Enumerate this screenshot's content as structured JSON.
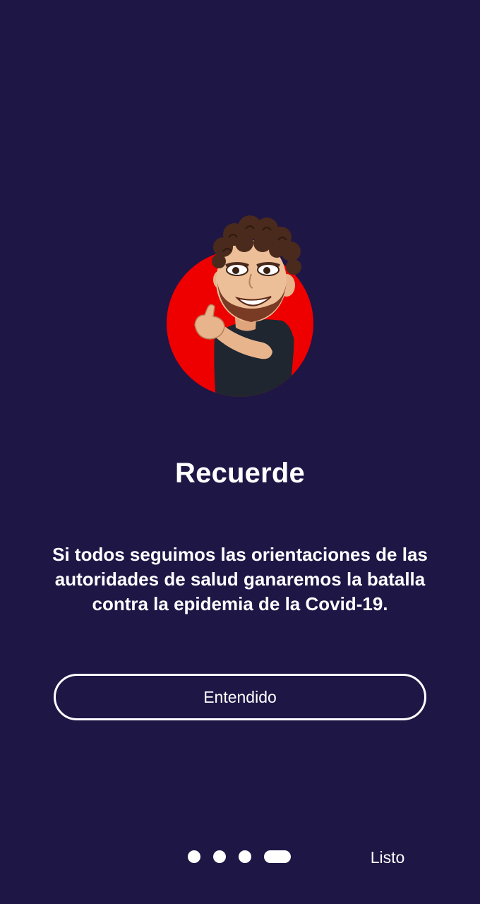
{
  "colors": {
    "background": "#1e1645",
    "text": "#ffffff",
    "avatar_circle": "#ee0000",
    "shirt": "#1f2630",
    "hair": "#4a2a1c",
    "skin": "#e8b48c"
  },
  "illustration": {
    "icon": "avatar-thumbs-up-illustration"
  },
  "title": "Recuerde",
  "message": "Si todos seguimos las orientaciones de las autoridades de salud ganaremos la batalla contra la epidemia de la Covid-19.",
  "primary_button": {
    "label": "Entendido"
  },
  "pager": {
    "total": 4,
    "current": 4
  },
  "done_button": {
    "label": "Listo"
  }
}
